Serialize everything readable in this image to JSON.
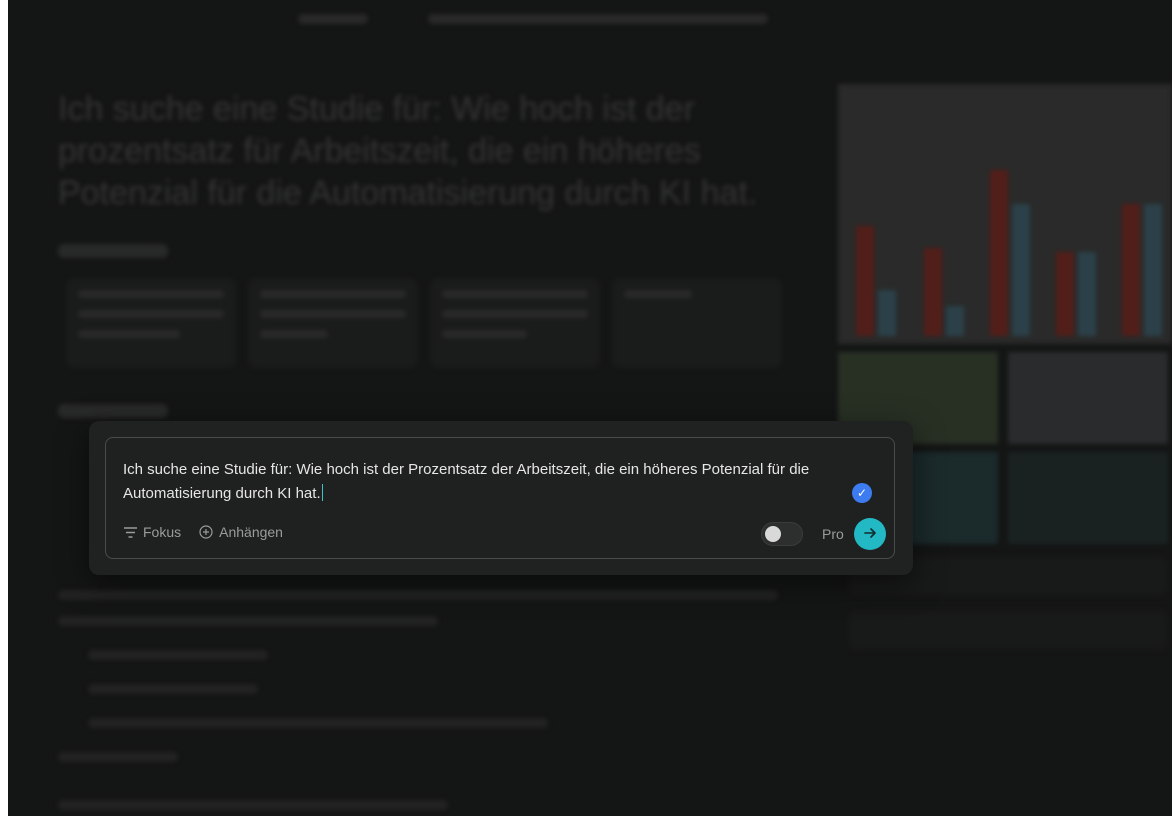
{
  "composer": {
    "query_text": "Ich suche eine Studie für: Wie hoch ist der Prozentsatz der Arbeitszeit, die ein höheres Potenzial für die Automatisierung durch KI hat.",
    "focus_label": "Fokus",
    "attach_label": "Anhängen",
    "pro_label": "Pro",
    "pro_enabled": false,
    "send_icon": "arrow-right-icon",
    "verified_icon": "check-icon"
  },
  "background": {
    "page_title": "Ich suche eine Studie für: Wie hoch ist der prozentsatz für Arbeitszeit, die ein höheres Potenzial für die Automatisierung durch KI hat."
  },
  "colors": {
    "accent": "#22b8c4",
    "check": "#3d7cf0",
    "overlay_bg": "#1b1c1c"
  }
}
